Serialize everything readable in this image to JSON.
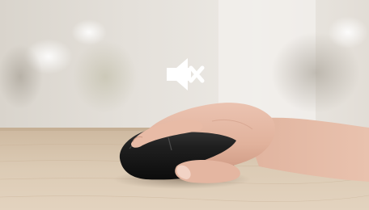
{
  "image": {
    "overlay_icon": "mute-speaker-icon",
    "subject": "hand-on-wireless-mouse",
    "colors": {
      "background": "#e6e2dc",
      "desk": "#d8c7b1",
      "mouse": "#1c1c1c",
      "skin": "#e3b6a1",
      "icon": "#ffffff"
    }
  }
}
